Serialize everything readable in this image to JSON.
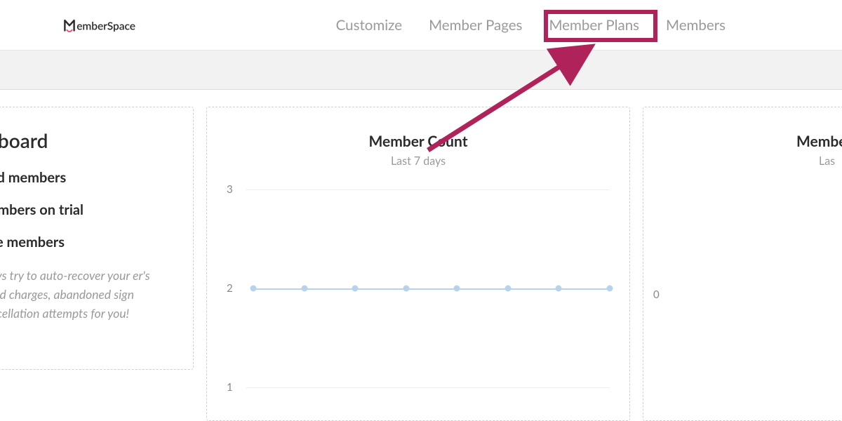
{
  "brand": "MemberSpace",
  "nav": {
    "items": [
      {
        "label": "Customize"
      },
      {
        "label": "Member Pages"
      },
      {
        "label": "Member Plans"
      },
      {
        "label": "Members"
      }
    ],
    "highlighted_index": 2
  },
  "dashboard": {
    "title": "shboard",
    "lines": [
      "paid members",
      "members on trial",
      "free members"
    ],
    "note": "lways try to auto-recover your er's failed charges, abandoned sign  cancellation attempts for you!"
  },
  "chart_data": {
    "type": "line",
    "title": "Member Count",
    "subtitle": "Last 7 days",
    "ylim": [
      1,
      3
    ],
    "yticks": [
      3,
      2,
      1
    ],
    "x": [
      0,
      1,
      2,
      3,
      4,
      5,
      6,
      7
    ],
    "values": [
      2,
      2,
      2,
      2,
      2,
      2,
      2,
      2
    ]
  },
  "revenue": {
    "title": "Member ",
    "subtitle": "Las",
    "yticks": [
      0
    ]
  }
}
